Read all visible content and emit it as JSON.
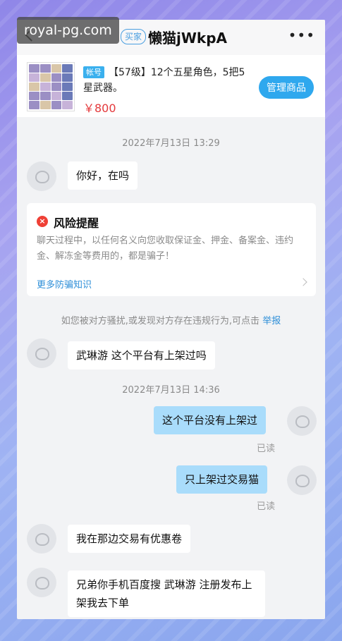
{
  "watermark": "royal-pg.com",
  "header": {
    "buyer_badge": "买家",
    "username": "懒猫jWkpA",
    "more": "•••"
  },
  "product": {
    "tag": "帐号",
    "title": "【57级】12个五星角色，5把5星武器。",
    "price": "￥800",
    "manage_button": "管理商品"
  },
  "chat": {
    "timestamp_1": "2022年7月13日 13:29",
    "msg_1": "你好，在吗",
    "risk": {
      "title": "风险提醒",
      "icon": "×",
      "text": "聊天过程中，以任何名义向您收取保证金、押金、备案金、违约金、解冻金等费用的，都是骗子！",
      "link": "更多防骗知识"
    },
    "report_text": "如您被对方骚扰,或发现对方存在违规行为,可点击",
    "report_link": "举报",
    "msg_2": "武琳游 这个平台有上架过吗",
    "timestamp_2": "2022年7月13日 14:36",
    "msg_3": "这个平台没有上架过",
    "read_1": "已读",
    "msg_4": "只上架过交易猫",
    "read_2": "已读",
    "msg_5": "我在那边交易有优惠卷",
    "msg_6": "兄弟你手机百度搜 武琳游 注册发布上架我去下单"
  }
}
